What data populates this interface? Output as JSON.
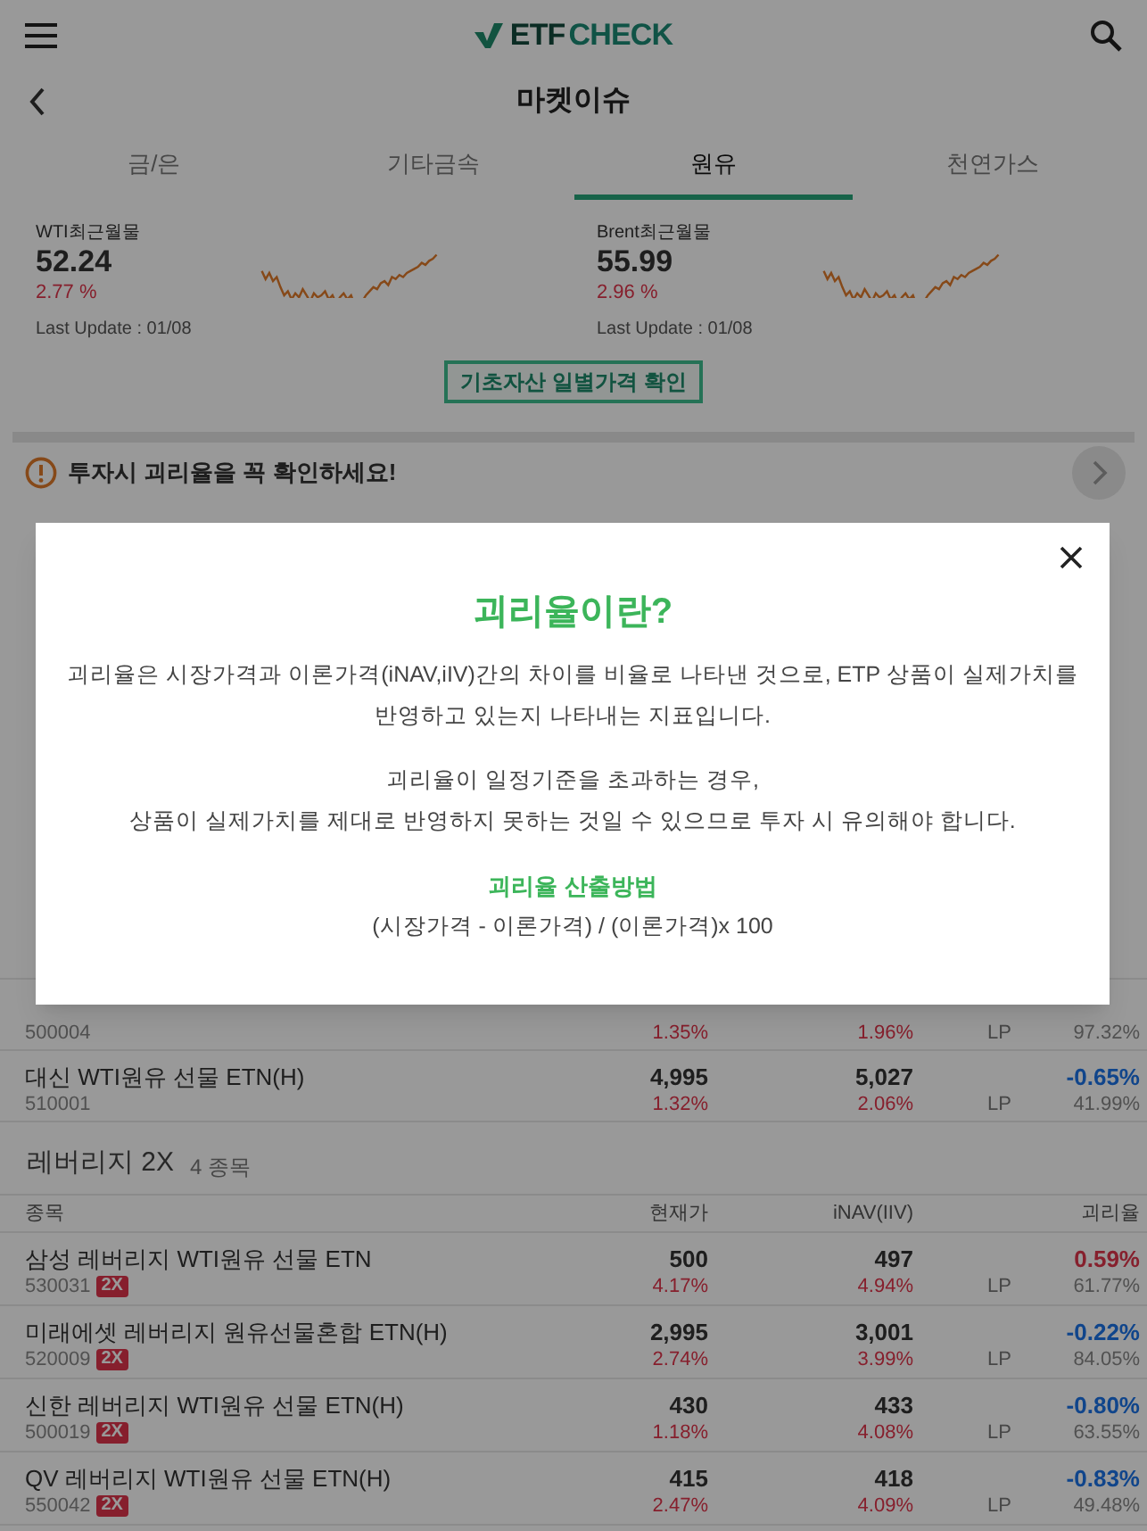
{
  "header": {
    "logo": [
      "ETF",
      "CHECK"
    ]
  },
  "page_title": "마켓이슈",
  "tabs": [
    {
      "label": "금/은",
      "selected": false
    },
    {
      "label": "기타금속",
      "selected": false
    },
    {
      "label": "원유",
      "selected": true
    },
    {
      "label": "천연가스",
      "selected": false
    }
  ],
  "quotes": [
    {
      "label": "WTI최근월물",
      "value": "52.24",
      "change": "2.77 %",
      "updated": "Last Update : 01/08"
    },
    {
      "label": "Brent최근월물",
      "value": "55.99",
      "change": "2.96 %",
      "updated": "Last Update : 01/08"
    }
  ],
  "daily_price_button": "기초자산 일별가격 확인",
  "notice": "투자시 괴리율을 꼭 확인하세요!",
  "rows": [
    {
      "code": "500004",
      "price_change": "1.35%",
      "inav_change": "1.96%",
      "lp": "LP",
      "lp_ratio": "97.32%"
    },
    {
      "name": "대신 WTI원유 선물 ETN(H)",
      "code": "510001",
      "price": "4,995",
      "price_change": "1.32%",
      "inav": "5,027",
      "inav_change": "2.06%",
      "lp": "LP",
      "premium": "-0.65%",
      "color": "#10458b",
      "lp_ratio": "41.99%"
    }
  ],
  "leverage": {
    "title": "레버리지 2X",
    "count": "4 종목",
    "columns": [
      "종목",
      "현재가",
      "iNAV(IIV)",
      "괴리율"
    ],
    "rows": [
      {
        "name": "삼성 레버리지 WTI원유 선물 ETN",
        "code": "530031",
        "badge": "2X",
        "price": "500",
        "price_change": "4.17%",
        "inav": "497",
        "inav_change": "4.94%",
        "lp": "LP",
        "premium": "0.59%",
        "color": "#86202d",
        "lp_ratio": "61.77%"
      },
      {
        "name": "미래에셋 레버리지 원유선물혼합 ETN(H)",
        "code": "520009",
        "badge": "2X",
        "price": "2,995",
        "price_change": "2.74%",
        "inav": "3,001",
        "inav_change": "3.99%",
        "lp": "LP",
        "premium": "-0.22%",
        "color": "#10458b",
        "lp_ratio": "84.05%"
      },
      {
        "name": "신한 레버리지 WTI원유 선물 ETN(H)",
        "code": "500019",
        "badge": "2X",
        "price": "430",
        "price_change": "1.18%",
        "inav": "433",
        "inav_change": "4.08%",
        "lp": "LP",
        "premium": "-0.80%",
        "color": "#10458b",
        "lp_ratio": "63.55%"
      },
      {
        "name": "QV 레버리지 WTI원유 선물 ETN(H)",
        "code": "550042",
        "badge": "2X",
        "price": "415",
        "price_change": "2.47%",
        "inav": "418",
        "inav_change": "4.09%",
        "lp": "LP",
        "premium": "-0.83%",
        "color": "#10458b",
        "lp_ratio": "49.48%"
      }
    ]
  },
  "modal": {
    "title": "괴리율이란?",
    "paragraphs": [
      [
        "괴리율은 시장가격과 이론가격(iNAV,iIV)간의 차이를 비율로 나타낸 것으로, ETP 상품이 실제가치를 반영하고 있는지 나타내는 지표입니다."
      ],
      [
        "괴리율이 일정기준을 초과하는 경우,",
        "상품이 실제가치를 제대로 반영하지 못하는 것일 수 있으므로 투자 시 유의해야 합니다."
      ]
    ],
    "method_title": "괴리율 산출방법",
    "formula": "(시장가격 - 이론가격) / (이론가격)x 100"
  }
}
